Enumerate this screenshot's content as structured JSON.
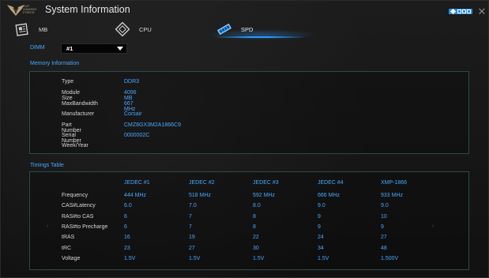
{
  "window": {
    "title": "System Information",
    "logo_text": [
      "TUF",
      "GAMING",
      "FORCE"
    ]
  },
  "tabs": [
    {
      "label": "MB",
      "icon": "motherboard-icon",
      "active": false
    },
    {
      "label": "CPU",
      "icon": "cpu-icon",
      "active": false
    },
    {
      "label": "SPD",
      "icon": "memory-module-icon",
      "active": true
    }
  ],
  "dimm": {
    "label": "DIMM",
    "selected": "#1"
  },
  "memory_info": {
    "section_label": "Memory Information",
    "rows": [
      {
        "key": "Type",
        "value": "DDR3"
      },
      {
        "key": "Module Size",
        "value": "4096 MB"
      },
      {
        "key": "MaxBandwidth",
        "value": "667 MHz"
      },
      {
        "key": "Manufacturer",
        "value": "Corsair"
      },
      {
        "key": "Part Number",
        "value": "CMZ8GX3M2A1866C9"
      },
      {
        "key": "Serial Number",
        "value": "0000002C"
      },
      {
        "key": "Week/Year",
        "value": ""
      }
    ]
  },
  "timings": {
    "section_label": "Timings Table",
    "columns": [
      "JEDEC #1",
      "JEDEC #2",
      "JEDEC #3",
      "JEDEC #4",
      "XMP-1866"
    ],
    "rows": [
      {
        "label": "Frequency",
        "values": [
          "444 MHz",
          "518 MHz",
          "592 MHz",
          "666 MHz",
          "933 MHz"
        ]
      },
      {
        "label": "CAS#Latency",
        "values": [
          "6.0",
          "7.0",
          "8.0",
          "9.0",
          "9.0"
        ]
      },
      {
        "label": "RAS#to CAS",
        "values": [
          "6",
          "7",
          "8",
          "9",
          "10"
        ]
      },
      {
        "label": "RAS#to Precharge",
        "values": [
          "6",
          "7",
          "8",
          "9",
          "9"
        ]
      },
      {
        "label": "tRAS",
        "values": [
          "16",
          "19",
          "22",
          "24",
          "27"
        ]
      },
      {
        "label": "tRC",
        "values": [
          "23",
          "27",
          "30",
          "34",
          "48"
        ]
      },
      {
        "label": "Voltage",
        "values": [
          "1.5V",
          "1.5V",
          "1.5V",
          "1.5V",
          "1.500V"
        ]
      }
    ]
  },
  "colors": {
    "accent": "#48a8ff",
    "background": "#141414",
    "panel_border": "#2e4a4a"
  }
}
